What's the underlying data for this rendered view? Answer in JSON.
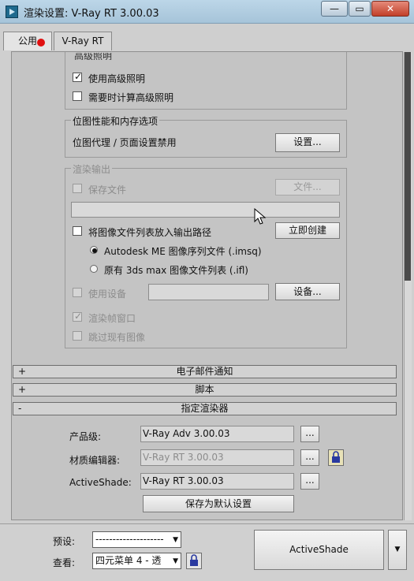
{
  "window": {
    "title": "渲染设置: V-Ray RT 3.00.03",
    "minimize_glyph": "—",
    "restore_glyph": "▭",
    "close_glyph": "✕"
  },
  "tabs": [
    {
      "label": "公用"
    },
    {
      "label": "V-Ray RT"
    }
  ],
  "advanced_lighting": {
    "partial_title": "高级照明",
    "use_label": "使用高级照明",
    "use_checked": true,
    "compute_label": "需要时计算高级照明",
    "compute_checked": false
  },
  "bitmap_group": {
    "title": "位图性能和内存选项",
    "status_text": "位图代理 / 页面设置禁用",
    "setup_button": "设置..."
  },
  "render_output": {
    "title": "渲染输出",
    "save_file_label": "保存文件",
    "files_button": "文件...",
    "path_value": "",
    "put_list_label": "将图像文件列表放入输出路径",
    "create_now_button": "立即创建",
    "radio_autodesk_label": "Autodesk ME 图像序列文件 (.imsq)",
    "radio_legacy_label": "原有 3ds max 图像文件列表 (.ifl)",
    "use_device_label": "使用设备",
    "device_button": "设备...",
    "render_frame_window_label": "渲染帧窗口",
    "skip_existing_label": "跳过现有图像"
  },
  "rollouts": [
    {
      "sign": "+",
      "title": "电子邮件通知"
    },
    {
      "sign": "+",
      "title": "脚本"
    },
    {
      "sign": "-",
      "title": "指定渲染器"
    }
  ],
  "assign_renderer": {
    "production_label": "产品级:",
    "production_value": "V-Ray Adv 3.00.03",
    "material_editor_label": "材质编辑器:",
    "material_editor_value": "V-Ray RT 3.00.03",
    "activeshade_label": "ActiveShade:",
    "activeshade_value": "V-Ray RT 3.00.03",
    "browse_button": "...",
    "save_default_button": "保存为默认设置"
  },
  "bottom": {
    "preset_label": "预设:",
    "preset_value": "--------------------",
    "view_label": "查看:",
    "view_value": "四元菜单 4 - 透",
    "activeshade_button": "ActiveShade",
    "dropdown_arrow": "▼"
  }
}
